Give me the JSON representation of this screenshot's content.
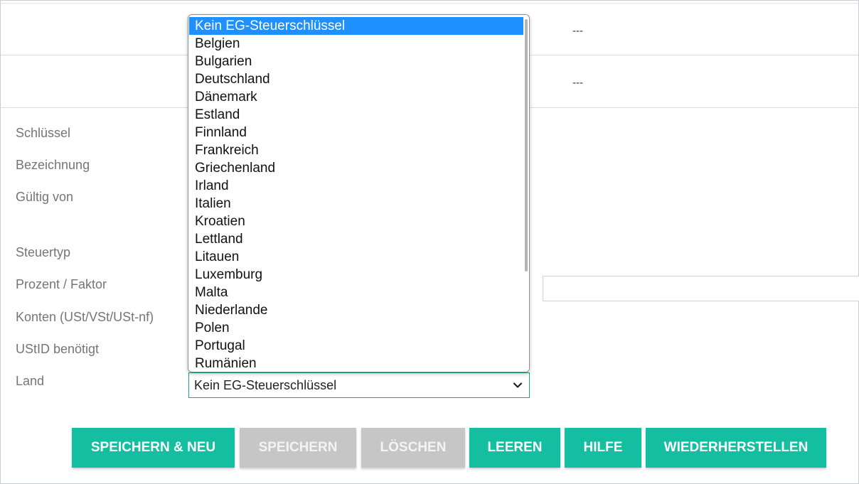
{
  "table": {
    "row1_value": "---",
    "row2_value": "---"
  },
  "form": {
    "labels": {
      "schluessel": "Schlüssel",
      "bezeichnung": "Bezeichnung",
      "gueltig_von": "Gültig von",
      "steuertyp": "Steuertyp",
      "prozent": "Prozent / Faktor",
      "konten": "Konten (USt/VSt/USt-nf)",
      "ustid": "UStID benötigt",
      "land": "Land"
    },
    "land_value": "Kein EG-Steuerschlüssel"
  },
  "dropdown": {
    "selected_index": 0,
    "options": [
      "Kein EG-Steuerschlüssel",
      "Belgien",
      "Bulgarien",
      "Deutschland",
      "Dänemark",
      "Estland",
      "Finnland",
      "Frankreich",
      "Griechenland",
      "Irland",
      "Italien",
      "Kroatien",
      "Lettland",
      "Litauen",
      "Luxemburg",
      "Malta",
      "Niederlande",
      "Polen",
      "Portugal",
      "Rumänien"
    ]
  },
  "buttons": {
    "save_new": "SPEICHERN & NEU",
    "save": "SPEICHERN",
    "delete": "LÖSCHEN",
    "clear": "LEEREN",
    "help": "HILFE",
    "restore": "WIEDERHERSTELLEN"
  },
  "colors": {
    "primary": "#13bfa0",
    "disabled": "#c6c6c6",
    "selection": "#1e90ff"
  }
}
